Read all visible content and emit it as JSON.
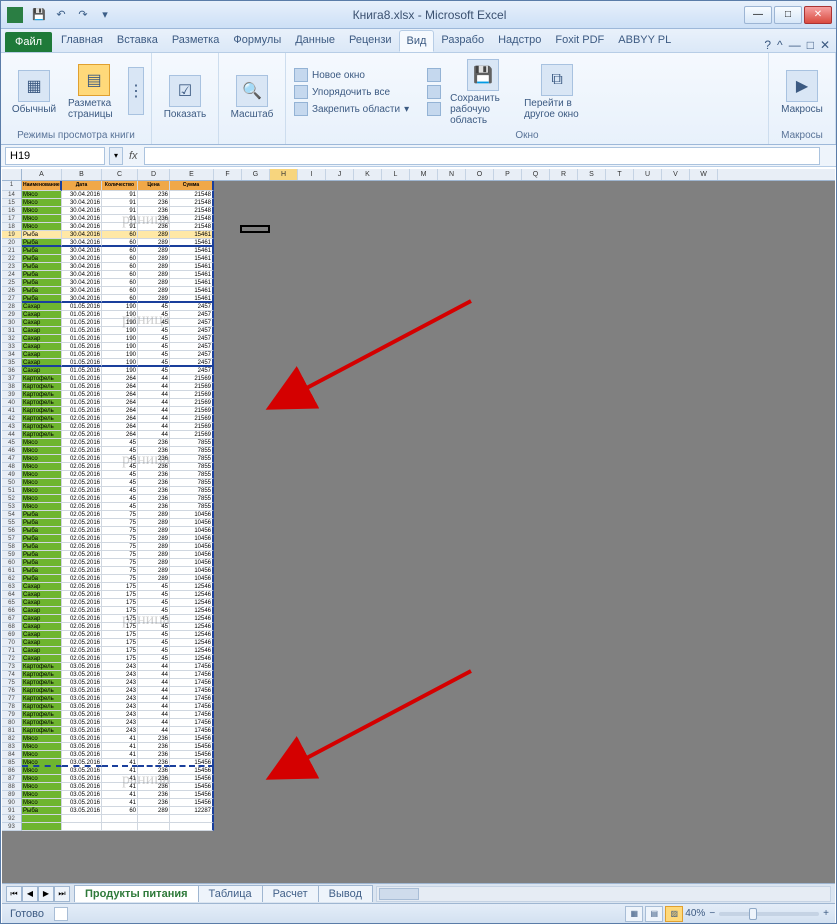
{
  "window": {
    "title": "Книга8.xlsx - Microsoft Excel"
  },
  "qat": {
    "save": "💾",
    "undo": "↶",
    "redo": "↷"
  },
  "winbtns": {
    "min": "—",
    "max": "□",
    "close": "✕"
  },
  "tabs": {
    "file": "Файл",
    "items": [
      "Главная",
      "Вставка",
      "Разметка",
      "Формулы",
      "Данные",
      "Рецензи",
      "Вид",
      "Разрабо",
      "Надстро",
      "Foxit PDF",
      "ABBYY PL"
    ],
    "active": "Вид"
  },
  "help": {
    "q": "?",
    "up": "^",
    "minw": "—",
    "maxw": "□",
    "closew": "✕"
  },
  "ribbon": {
    "group1": {
      "label": "Режимы просмотра книги",
      "normal": "Обычный",
      "pagelayout": "Разметка страницы"
    },
    "group2": {
      "show": "Показать"
    },
    "group3": {
      "zoom": "Масштаб"
    },
    "group4": {
      "label": "Окно",
      "newwin": "Новое окно",
      "arrange": "Упорядочить все",
      "freeze": "Закрепить области",
      "savews": "Сохранить рабочую область",
      "switch": "Перейти в другое окно"
    },
    "group5": {
      "label": "Макросы",
      "macros": "Макросы"
    }
  },
  "namebox": {
    "value": "H19"
  },
  "fx": {
    "label": "fx"
  },
  "columns": [
    "A",
    "B",
    "C",
    "D",
    "E",
    "F",
    "G",
    "H",
    "I",
    "J",
    "K",
    "L",
    "M",
    "N",
    "O",
    "P",
    "Q",
    "R",
    "S",
    "T",
    "U",
    "V",
    "W"
  ],
  "header_row": {
    "n": 1,
    "a": "Наименование",
    "b": "Дата",
    "c": "Количество",
    "d": "Цена",
    "e": "Сумма"
  },
  "selected_row": 19,
  "selected_col": "H",
  "watermarks": [
    "раница",
    "раница",
    "раница",
    "раница",
    "раница"
  ],
  "rows": [
    {
      "n": 14,
      "a": "Мясо",
      "b": "30.04.2016",
      "c": 91,
      "d": 236,
      "e": 21548
    },
    {
      "n": 15,
      "a": "Мясо",
      "b": "30.04.2016",
      "c": 91,
      "d": 236,
      "e": 21548
    },
    {
      "n": 16,
      "a": "Мясо",
      "b": "30.04.2016",
      "c": 91,
      "d": 236,
      "e": 21548
    },
    {
      "n": 17,
      "a": "Мясо",
      "b": "30.04.2016",
      "c": 91,
      "d": 236,
      "e": 21548
    },
    {
      "n": 18,
      "a": "Мясо",
      "b": "30.04.2016",
      "c": 91,
      "d": 236,
      "e": 21548
    },
    {
      "n": 19,
      "a": "Рыба",
      "b": "30.04.2016",
      "c": 60,
      "d": 289,
      "e": 15461
    },
    {
      "n": 20,
      "a": "Рыба",
      "b": "30.04.2016",
      "c": 60,
      "d": 289,
      "e": 15461,
      "pb": true
    },
    {
      "n": 21,
      "a": "Рыба",
      "b": "30.04.2016",
      "c": 60,
      "d": 289,
      "e": 15461
    },
    {
      "n": 22,
      "a": "Рыба",
      "b": "30.04.2016",
      "c": 60,
      "d": 289,
      "e": 15461
    },
    {
      "n": 23,
      "a": "Рыба",
      "b": "30.04.2016",
      "c": 60,
      "d": 289,
      "e": 15461
    },
    {
      "n": 24,
      "a": "Рыба",
      "b": "30.04.2016",
      "c": 60,
      "d": 289,
      "e": 15461
    },
    {
      "n": 25,
      "a": "Рыба",
      "b": "30.04.2016",
      "c": 60,
      "d": 289,
      "e": 15461
    },
    {
      "n": 26,
      "a": "Рыба",
      "b": "30.04.2016",
      "c": 60,
      "d": 289,
      "e": 15461
    },
    {
      "n": 27,
      "a": "Рыба",
      "b": "30.04.2016",
      "c": 60,
      "d": 289,
      "e": 15461,
      "pb": true
    },
    {
      "n": 28,
      "a": "Сахар",
      "b": "01.05.2016",
      "c": 190,
      "d": 45,
      "e": 2457
    },
    {
      "n": 29,
      "a": "Сахар",
      "b": "01.05.2016",
      "c": 190,
      "d": 45,
      "e": 2457
    },
    {
      "n": 30,
      "a": "Сахар",
      "b": "01.05.2016",
      "c": 190,
      "d": 45,
      "e": 2457
    },
    {
      "n": 31,
      "a": "Сахар",
      "b": "01.05.2016",
      "c": 190,
      "d": 45,
      "e": 2457
    },
    {
      "n": 32,
      "a": "Сахар",
      "b": "01.05.2016",
      "c": 190,
      "d": 45,
      "e": 2457
    },
    {
      "n": 33,
      "a": "Сахар",
      "b": "01.05.2016",
      "c": 190,
      "d": 45,
      "e": 2457
    },
    {
      "n": 34,
      "a": "Сахар",
      "b": "01.05.2016",
      "c": 190,
      "d": 45,
      "e": 2457
    },
    {
      "n": 35,
      "a": "Сахар",
      "b": "01.05.2016",
      "c": 190,
      "d": 45,
      "e": 2457,
      "pb": true
    },
    {
      "n": 36,
      "a": "Сахар",
      "b": "01.05.2016",
      "c": 190,
      "d": 45,
      "e": 2457
    },
    {
      "n": 37,
      "a": "Картофель",
      "b": "01.05.2016",
      "c": 264,
      "d": 44,
      "e": 21569
    },
    {
      "n": 38,
      "a": "Картофель",
      "b": "01.05.2016",
      "c": 264,
      "d": 44,
      "e": 21569
    },
    {
      "n": 39,
      "a": "Картофель",
      "b": "01.05.2016",
      "c": 264,
      "d": 44,
      "e": 21569
    },
    {
      "n": 40,
      "a": "Картофель",
      "b": "01.05.2016",
      "c": 264,
      "d": 44,
      "e": 21569
    },
    {
      "n": 41,
      "a": "Картофель",
      "b": "01.05.2016",
      "c": 264,
      "d": 44,
      "e": 21569
    },
    {
      "n": 42,
      "a": "Картофель",
      "b": "02.05.2016",
      "c": 264,
      "d": 44,
      "e": 21569
    },
    {
      "n": 43,
      "a": "Картофель",
      "b": "02.05.2016",
      "c": 264,
      "d": 44,
      "e": 21569
    },
    {
      "n": 44,
      "a": "Картофель",
      "b": "02.05.2016",
      "c": 264,
      "d": 44,
      "e": 21569
    },
    {
      "n": 45,
      "a": "Мясо",
      "b": "02.05.2016",
      "c": 45,
      "d": 236,
      "e": 7855
    },
    {
      "n": 46,
      "a": "Мясо",
      "b": "02.05.2016",
      "c": 45,
      "d": 236,
      "e": 7855
    },
    {
      "n": 47,
      "a": "Мясо",
      "b": "02.05.2016",
      "c": 45,
      "d": 236,
      "e": 7855
    },
    {
      "n": 48,
      "a": "Мясо",
      "b": "02.05.2016",
      "c": 45,
      "d": 236,
      "e": 7855
    },
    {
      "n": 49,
      "a": "Мясо",
      "b": "02.05.2016",
      "c": 45,
      "d": 236,
      "e": 7855
    },
    {
      "n": 50,
      "a": "Мясо",
      "b": "02.05.2016",
      "c": 45,
      "d": 236,
      "e": 7855
    },
    {
      "n": 51,
      "a": "Мясо",
      "b": "02.05.2016",
      "c": 45,
      "d": 236,
      "e": 7855
    },
    {
      "n": 52,
      "a": "Мясо",
      "b": "02.05.2016",
      "c": 45,
      "d": 236,
      "e": 7855
    },
    {
      "n": 53,
      "a": "Мясо",
      "b": "02.05.2016",
      "c": 45,
      "d": 236,
      "e": 7855
    },
    {
      "n": 54,
      "a": "Рыба",
      "b": "02.05.2016",
      "c": 75,
      "d": 289,
      "e": 10456
    },
    {
      "n": 55,
      "a": "Рыба",
      "b": "02.05.2016",
      "c": 75,
      "d": 289,
      "e": 10456
    },
    {
      "n": 56,
      "a": "Рыба",
      "b": "02.05.2016",
      "c": 75,
      "d": 289,
      "e": 10456
    },
    {
      "n": 57,
      "a": "Рыба",
      "b": "02.05.2016",
      "c": 75,
      "d": 289,
      "e": 10456
    },
    {
      "n": 58,
      "a": "Рыба",
      "b": "02.05.2016",
      "c": 75,
      "d": 289,
      "e": 10456
    },
    {
      "n": 59,
      "a": "Рыба",
      "b": "02.05.2016",
      "c": 75,
      "d": 289,
      "e": 10456
    },
    {
      "n": 60,
      "a": "Рыба",
      "b": "02.05.2016",
      "c": 75,
      "d": 289,
      "e": 10456
    },
    {
      "n": 61,
      "a": "Рыба",
      "b": "02.05.2016",
      "c": 75,
      "d": 289,
      "e": 10456
    },
    {
      "n": 62,
      "a": "Рыба",
      "b": "02.05.2016",
      "c": 75,
      "d": 289,
      "e": 10456
    },
    {
      "n": 63,
      "a": "Сахар",
      "b": "02.05.2016",
      "c": 175,
      "d": 45,
      "e": 12546
    },
    {
      "n": 64,
      "a": "Сахар",
      "b": "02.05.2016",
      "c": 175,
      "d": 45,
      "e": 12546
    },
    {
      "n": 65,
      "a": "Сахар",
      "b": "02.05.2016",
      "c": 175,
      "d": 45,
      "e": 12546
    },
    {
      "n": 66,
      "a": "Сахар",
      "b": "02.05.2016",
      "c": 175,
      "d": 45,
      "e": 12546
    },
    {
      "n": 67,
      "a": "Сахар",
      "b": "02.05.2016",
      "c": 175,
      "d": 45,
      "e": 12546
    },
    {
      "n": 68,
      "a": "Сахар",
      "b": "02.05.2016",
      "c": 175,
      "d": 45,
      "e": 12546
    },
    {
      "n": 69,
      "a": "Сахар",
      "b": "02.05.2016",
      "c": 175,
      "d": 45,
      "e": 12546
    },
    {
      "n": 70,
      "a": "Сахар",
      "b": "02.05.2016",
      "c": 175,
      "d": 45,
      "e": 12546
    },
    {
      "n": 71,
      "a": "Сахар",
      "b": "02.05.2016",
      "c": 175,
      "d": 45,
      "e": 12546
    },
    {
      "n": 72,
      "a": "Сахар",
      "b": "02.05.2016",
      "c": 175,
      "d": 45,
      "e": 12546
    },
    {
      "n": 73,
      "a": "Картофель",
      "b": "03.05.2016",
      "c": 243,
      "d": 44,
      "e": 17456
    },
    {
      "n": 74,
      "a": "Картофель",
      "b": "03.05.2016",
      "c": 243,
      "d": 44,
      "e": 17456
    },
    {
      "n": 75,
      "a": "Картофель",
      "b": "03.05.2016",
      "c": 243,
      "d": 44,
      "e": 17456
    },
    {
      "n": 76,
      "a": "Картофель",
      "b": "03.05.2016",
      "c": 243,
      "d": 44,
      "e": 17456
    },
    {
      "n": 77,
      "a": "Картофель",
      "b": "03.05.2016",
      "c": 243,
      "d": 44,
      "e": 17456
    },
    {
      "n": 78,
      "a": "Картофель",
      "b": "03.05.2016",
      "c": 243,
      "d": 44,
      "e": 17456
    },
    {
      "n": 79,
      "a": "Картофель",
      "b": "03.05.2016",
      "c": 243,
      "d": 44,
      "e": 17456
    },
    {
      "n": 80,
      "a": "Картофель",
      "b": "03.05.2016",
      "c": 243,
      "d": 44,
      "e": 17456
    },
    {
      "n": 81,
      "a": "Картофель",
      "b": "03.05.2016",
      "c": 243,
      "d": 44,
      "e": 17456
    },
    {
      "n": 82,
      "a": "Мясо",
      "b": "03.05.2016",
      "c": 41,
      "d": 236,
      "e": 15456
    },
    {
      "n": 83,
      "a": "Мясо",
      "b": "03.05.2016",
      "c": 41,
      "d": 236,
      "e": 15456
    },
    {
      "n": 84,
      "a": "Мясо",
      "b": "03.05.2016",
      "c": 41,
      "d": 236,
      "e": 15456
    },
    {
      "n": 85,
      "a": "Мясо",
      "b": "03.05.2016",
      "c": 41,
      "d": 236,
      "e": 15456,
      "pbd": true
    },
    {
      "n": 86,
      "a": "Мясо",
      "b": "03.05.2016",
      "c": 41,
      "d": 236,
      "e": 15456
    },
    {
      "n": 87,
      "a": "Мясо",
      "b": "03.05.2016",
      "c": 41,
      "d": 236,
      "e": 15456
    },
    {
      "n": 88,
      "a": "Мясо",
      "b": "03.05.2016",
      "c": 41,
      "d": 236,
      "e": 15456
    },
    {
      "n": 89,
      "a": "Мясо",
      "b": "03.05.2016",
      "c": 41,
      "d": 236,
      "e": 15456
    },
    {
      "n": 90,
      "a": "Мясо",
      "b": "03.05.2016",
      "c": 41,
      "d": 236,
      "e": 15456
    },
    {
      "n": 91,
      "a": "Рыба",
      "b": "03.05.2016",
      "c": 60,
      "d": 289,
      "e": 12287
    },
    {
      "n": 92,
      "a": "",
      "b": "",
      "c": "",
      "d": "",
      "e": ""
    },
    {
      "n": 93,
      "a": "",
      "b": "",
      "c": "",
      "d": "",
      "e": ""
    }
  ],
  "sheets": {
    "active": "Продукты питания",
    "others": [
      "Таблица",
      "Расчет",
      "Вывод"
    ]
  },
  "status": {
    "ready": "Готово",
    "zoom": "40%"
  }
}
